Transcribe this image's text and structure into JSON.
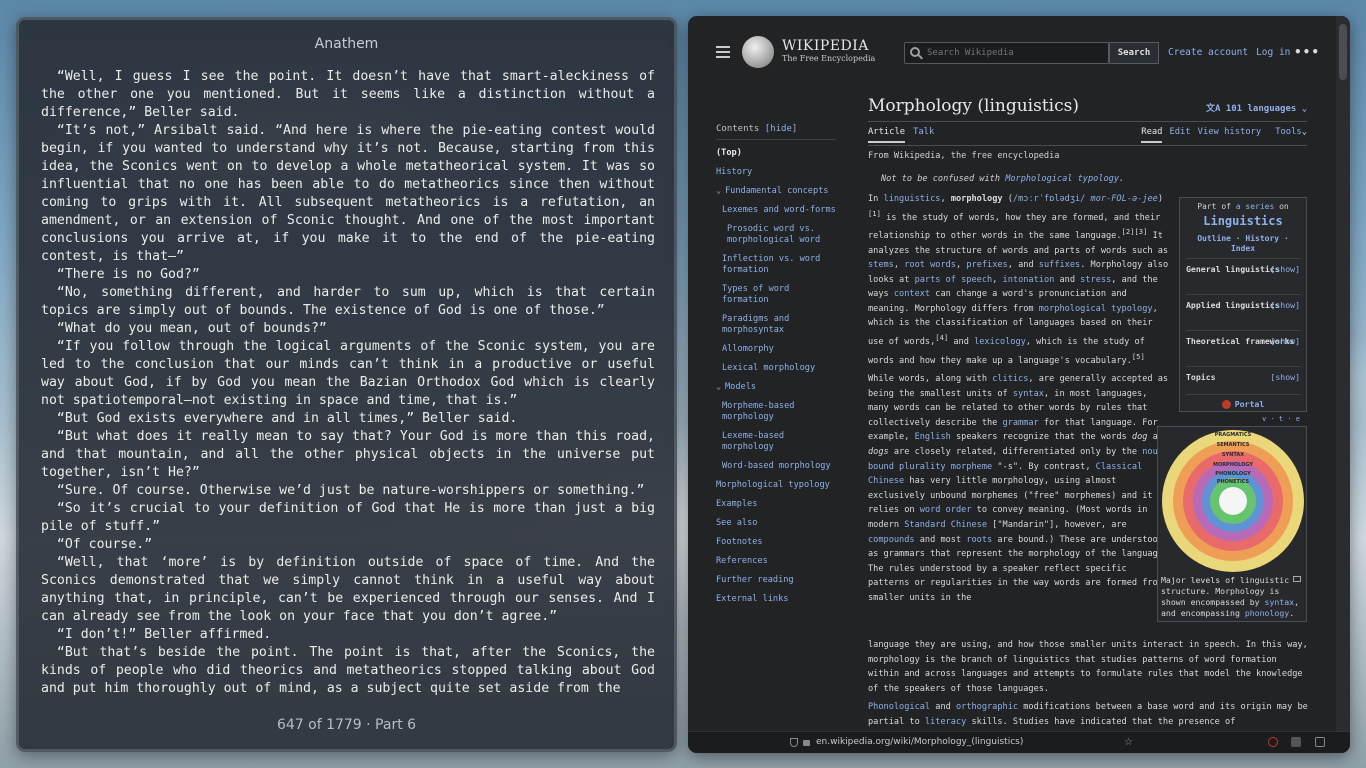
{
  "reader": {
    "title": "Anathem",
    "paragraphs": [
      "“Well, I guess I see the point. It doesn’t have that smart-aleckiness of the other one you mentioned. But it seems like a distinction without a difference,” Beller said.",
      "“It’s not,” Arsibalt said. “And here is where the pie-eating contest would begin, if you wanted to understand why it’s not. Because, starting from this idea, the Sconics went on to develop a whole metatheorical system. It was so influential that no one has been able to do metatheorics since then without coming to grips with it. All subsequent metatheorics is a refutation, an amendment, or an extension of Sconic thought. And one of the most important conclusions you arrive at, if you make it to the end of the pie-eating contest, is that—”",
      "“There is no God?”",
      "“No, something different, and harder to sum up, which is that certain topics are simply out of bounds. The existence of God is one of those.”",
      "“What do you mean, out of bounds?”",
      "“If you follow through the logical arguments of the Sconic system, you are led to the conclusion that our minds can’t think in a productive or useful way about God, if by God you mean the Bazian Orthodox God which is clearly not spatiotemporal—not existing in space and time, that is.”",
      "“But God exists everywhere and in all times,” Beller said.",
      "“But what does it really mean to say that? Your God is more than this road, and that mountain, and all the other physical objects in the universe put together, isn’t He?”",
      "“Sure. Of course. Otherwise we’d just be nature-worshippers or something.”",
      "“So it’s crucial to your definition of God that He is more than just a big pile of stuff.”",
      "“Of course.”",
      "“Well, that ‘more’ is by definition outside of space of time. And the Sconics demonstrated that we simply cannot think in a useful way about anything that, in principle, can’t be experienced through our senses. And I can already see from the look on your face that you don’t agree.”",
      "“I don’t!” Beller affirmed.",
      "“But that’s beside the point. The point is that, after the Sconics, the kinds of people who did theorics and metatheorics stopped talking about God and put him thoroughly out of mind, as a subject quite set aside from the"
    ],
    "footer": "647 of 1779 · Part 6"
  },
  "browser": {
    "logo_name": "WIKIPEDIA",
    "logo_tagline": "The Free Encyclopedia",
    "search_placeholder": "Search Wikipedia",
    "search_button": "Search",
    "create_account": "Create account",
    "log_in": "Log in",
    "more": "•••",
    "toc_title": "Contents",
    "toc_hide": "[hide]",
    "toc": [
      {
        "label": "(Top)",
        "kind": "top"
      },
      {
        "label": "History",
        "kind": "item"
      },
      {
        "label": "Fundamental concepts",
        "kind": "group"
      },
      {
        "label": "Lexemes and word-forms",
        "kind": "sub"
      },
      {
        "label": "Prosodic word vs. morphological word",
        "kind": "sub2"
      },
      {
        "label": "Inflection vs. word formation",
        "kind": "sub"
      },
      {
        "label": "Types of word formation",
        "kind": "sub"
      },
      {
        "label": "Paradigms and morphosyntax",
        "kind": "sub"
      },
      {
        "label": "Allomorphy",
        "kind": "sub"
      },
      {
        "label": "Lexical morphology",
        "kind": "sub"
      },
      {
        "label": "Models",
        "kind": "group"
      },
      {
        "label": "Morpheme-based morphology",
        "kind": "sub"
      },
      {
        "label": "Lexeme-based morphology",
        "kind": "sub"
      },
      {
        "label": "Word-based morphology",
        "kind": "sub"
      },
      {
        "label": "Morphological typology",
        "kind": "item"
      },
      {
        "label": "Examples",
        "kind": "item"
      },
      {
        "label": "See also",
        "kind": "item"
      },
      {
        "label": "Footnotes",
        "kind": "item"
      },
      {
        "label": "References",
        "kind": "item"
      },
      {
        "label": "Further reading",
        "kind": "item"
      },
      {
        "label": "External links",
        "kind": "item"
      }
    ],
    "article_title": "Morphology (linguistics)",
    "languages": "101 languages",
    "tab_article": "Article",
    "tab_talk": "Talk",
    "tab_read": "Read",
    "tab_edit": "Edit",
    "tab_history": "View history",
    "tab_tools": "Tools",
    "from": "From Wikipedia, the free encyclopedia",
    "hatnote_prefix": "Not to be confused with ",
    "hatnote_link": "Morphological typology",
    "hatnote_suffix": ".",
    "sidebar_partof_1": "Part of ",
    "sidebar_partof_link": "a series",
    "sidebar_partof_2": " on",
    "sidebar_title": "Linguistics",
    "sidebar_outline": "Outline",
    "sidebar_history": "History",
    "sidebar_index": "Index",
    "sidebar_rows": [
      {
        "label": "General linguistics",
        "show": "[show]"
      },
      {
        "label": "Applied linguistics",
        "show": "[show]"
      },
      {
        "label": "Theoretical frameworks",
        "show": "[show]"
      },
      {
        "label": "Topics",
        "show": "[show]"
      }
    ],
    "sidebar_portal": "Portal",
    "sidebar_vte": "v · t · e",
    "figure_rings": [
      "PRAGMATICS",
      "SEMANTICS",
      "SYNTAX",
      "MORPHOLOGY",
      "PHONOLOGY",
      "PHONETICS"
    ],
    "figure_caption_1": "Major levels of linguistic structure. Morphology is shown encompassed by ",
    "figure_caption_link1": "syntax",
    "figure_caption_2": ", and encompassing ",
    "figure_caption_link2": "phonology",
    "figure_caption_3": ".",
    "url": "en.wikipedia.org/wiki/Morphology_(linguistics)"
  }
}
